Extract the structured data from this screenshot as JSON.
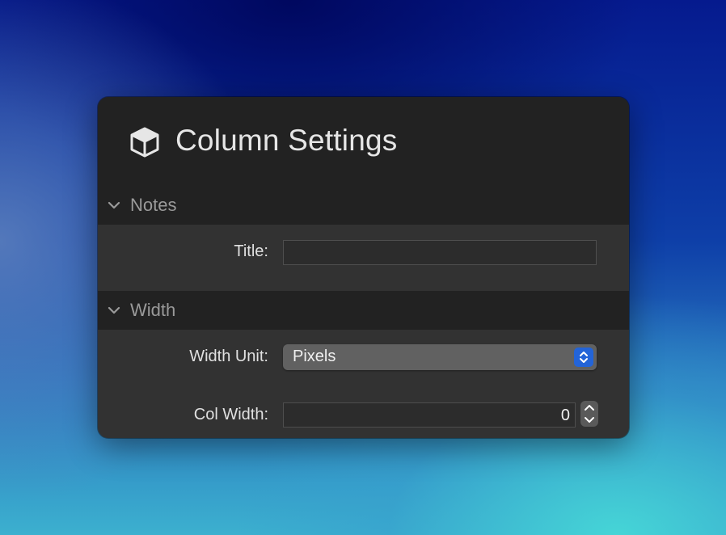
{
  "panel": {
    "title": "Column Settings",
    "icon": "cube-icon"
  },
  "sections": {
    "notes": {
      "label": "Notes",
      "title_label": "Title:",
      "title_value": ""
    },
    "width": {
      "label": "Width",
      "unit_label": "Width Unit:",
      "unit_value": "Pixels",
      "col_width_label": "Col Width:",
      "col_width_value": "0"
    }
  },
  "colors": {
    "accent": "#2364d8",
    "panel_background": "#323232",
    "header_background": "#222222"
  }
}
